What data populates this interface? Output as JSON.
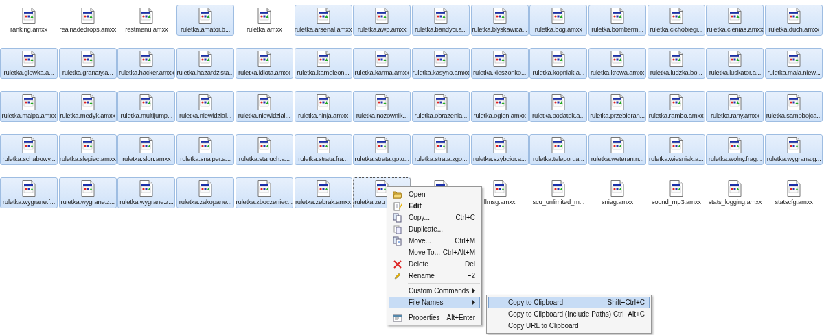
{
  "files": [
    {
      "label": "ranking.amxx",
      "selected": false,
      "focused": false
    },
    {
      "label": "realnadedrops.amxx",
      "selected": false,
      "focused": false
    },
    {
      "label": "restmenu.amxx",
      "selected": false,
      "focused": false
    },
    {
      "label": "ruletka.amator.b...",
      "selected": true,
      "focused": false
    },
    {
      "label": "ruletka.amxx",
      "selected": false,
      "focused": false
    },
    {
      "label": "ruletka.arsenal.amxx",
      "selected": true,
      "focused": false
    },
    {
      "label": "ruletka.awp.amxx",
      "selected": true,
      "focused": false
    },
    {
      "label": "ruletka.bandyci.a...",
      "selected": true,
      "focused": false
    },
    {
      "label": "ruletka.blyskawica...",
      "selected": true,
      "focused": false
    },
    {
      "label": "ruletka.bog.amxx",
      "selected": true,
      "focused": false
    },
    {
      "label": "ruletka.bomberm...",
      "selected": true,
      "focused": false
    },
    {
      "label": "ruletka.cichobiegi...",
      "selected": true,
      "focused": false
    },
    {
      "label": "ruletka.cienias.amxx",
      "selected": true,
      "focused": false
    },
    {
      "label": "ruletka.duch.amxx",
      "selected": true,
      "focused": false
    },
    {
      "label": "ruletka.glowka.a...",
      "selected": true,
      "focused": false
    },
    {
      "label": "ruletka.granaty.a...",
      "selected": true,
      "focused": false
    },
    {
      "label": "ruletka.hacker.amxx",
      "selected": true,
      "focused": false
    },
    {
      "label": "ruletka.hazardzista...",
      "selected": true,
      "focused": false
    },
    {
      "label": "ruletka.idiota.amxx",
      "selected": true,
      "focused": false
    },
    {
      "label": "ruletka.kameleon...",
      "selected": true,
      "focused": false
    },
    {
      "label": "ruletka.karma.amxx",
      "selected": true,
      "focused": false
    },
    {
      "label": "ruletka.kasyno.amxx",
      "selected": true,
      "focused": false
    },
    {
      "label": "ruletka.kieszonko...",
      "selected": true,
      "focused": false
    },
    {
      "label": "ruletka.kopniak.a...",
      "selected": true,
      "focused": false
    },
    {
      "label": "ruletka.krowa.amxx",
      "selected": true,
      "focused": false
    },
    {
      "label": "ruletka.ludzka.bo...",
      "selected": true,
      "focused": false
    },
    {
      "label": "ruletka.luskator.a...",
      "selected": true,
      "focused": false
    },
    {
      "label": "ruletka.mala.niew...",
      "selected": true,
      "focused": false
    },
    {
      "label": "ruletka.malpa.amxx",
      "selected": true,
      "focused": false
    },
    {
      "label": "ruletka.medyk.amxx",
      "selected": true,
      "focused": false
    },
    {
      "label": "ruletka.multijump...",
      "selected": true,
      "focused": false
    },
    {
      "label": "ruletka.niewidzial...",
      "selected": true,
      "focused": false
    },
    {
      "label": "ruletka.niewidzial...",
      "selected": true,
      "focused": false
    },
    {
      "label": "ruletka.ninja.amxx",
      "selected": true,
      "focused": false
    },
    {
      "label": "ruletka.nozownik...",
      "selected": true,
      "focused": false
    },
    {
      "label": "ruletka.obrazenia...",
      "selected": true,
      "focused": false
    },
    {
      "label": "ruletka.ogien.amxx",
      "selected": true,
      "focused": false
    },
    {
      "label": "ruletka.podatek.a...",
      "selected": true,
      "focused": false
    },
    {
      "label": "ruletka.przebieran...",
      "selected": true,
      "focused": false
    },
    {
      "label": "ruletka.rambo.amxx",
      "selected": true,
      "focused": false
    },
    {
      "label": "ruletka.rany.amxx",
      "selected": true,
      "focused": false
    },
    {
      "label": "ruletka.samobojca...",
      "selected": true,
      "focused": false
    },
    {
      "label": "ruletka.schabowy...",
      "selected": true,
      "focused": false
    },
    {
      "label": "ruletka.slepiec.amxx",
      "selected": true,
      "focused": false
    },
    {
      "label": "ruletka.slon.amxx",
      "selected": true,
      "focused": false
    },
    {
      "label": "ruletka.snajper.a...",
      "selected": true,
      "focused": false
    },
    {
      "label": "ruletka.staruch.a...",
      "selected": true,
      "focused": false
    },
    {
      "label": "ruletka.strata.fra...",
      "selected": true,
      "focused": false
    },
    {
      "label": "ruletka.strata.goto...",
      "selected": true,
      "focused": false
    },
    {
      "label": "ruletka.strata.zgo...",
      "selected": true,
      "focused": false
    },
    {
      "label": "ruletka.szybcior.a...",
      "selected": true,
      "focused": false
    },
    {
      "label": "ruletka.teleport.a...",
      "selected": true,
      "focused": false
    },
    {
      "label": "ruletka.weteran.n...",
      "selected": true,
      "focused": false
    },
    {
      "label": "ruletka.wiesniak.a...",
      "selected": true,
      "focused": false
    },
    {
      "label": "ruletka.wolny.frag...",
      "selected": true,
      "focused": false
    },
    {
      "label": "ruletka.wygrana.g...",
      "selected": true,
      "focused": false
    },
    {
      "label": "ruletka.wygrane.f...",
      "selected": true,
      "focused": false
    },
    {
      "label": "ruletka.wygrane.z...",
      "selected": true,
      "focused": false
    },
    {
      "label": "ruletka.wygrane.z...",
      "selected": true,
      "focused": false
    },
    {
      "label": "ruletka.zakopane...",
      "selected": true,
      "focused": false
    },
    {
      "label": "ruletka.zboczeniec...",
      "selected": true,
      "focused": false
    },
    {
      "label": "ruletka.zebrak.amxx",
      "selected": true,
      "focused": false
    },
    {
      "label": "ruletka.zeu",
      "selected": true,
      "focused": true
    },
    {
      "selected": false,
      "focused": false
    },
    {
      "label": "llmsg.amxx",
      "selected": false,
      "focused": false
    },
    {
      "label": "scu_unlimited_m...",
      "selected": false,
      "focused": false
    },
    {
      "label": "snieg.amxx",
      "selected": false,
      "focused": false
    },
    {
      "label": "sound_mp3.amxx",
      "selected": false,
      "focused": false
    },
    {
      "label": "stats_logging.amxx",
      "selected": false,
      "focused": false
    },
    {
      "label": "statscfg.amxx",
      "selected": false,
      "focused": false
    }
  ],
  "context_menu": {
    "sections": [
      [
        {
          "label": "Open",
          "bold": false,
          "submenu": false,
          "selected": false
        },
        {
          "label": "Edit",
          "bold": true,
          "submenu": false,
          "selected": false
        },
        {
          "label": "Copy...",
          "shortcut": "Ctrl+C",
          "bold": false,
          "submenu": false,
          "selected": false
        },
        {
          "label": "Duplicate...",
          "bold": false,
          "submenu": false,
          "selected": false
        },
        {
          "label": "Move...",
          "shortcut": "Ctrl+M",
          "bold": false,
          "submenu": false,
          "selected": false
        },
        {
          "label": "Move To...",
          "shortcut": "Ctrl+Alt+M",
          "bold": false,
          "submenu": false,
          "selected": false
        },
        {
          "label": "Delete",
          "shortcut": "Del",
          "bold": false,
          "submenu": false,
          "selected": false
        },
        {
          "label": "Rename",
          "shortcut": "F2",
          "bold": false,
          "submenu": false,
          "selected": false
        }
      ],
      [
        {
          "label": "Custom Commands",
          "bold": false,
          "submenu": true,
          "selected": false
        },
        {
          "label": "File Names",
          "bold": false,
          "submenu": true,
          "selected": true
        }
      ],
      [
        {
          "label": "Properties",
          "shortcut": "Alt+Enter",
          "bold": false,
          "submenu": false,
          "selected": false
        }
      ]
    ]
  },
  "submenu": {
    "items": [
      {
        "label": "Copy to Clipboard",
        "shortcut": "Shift+Ctrl+C",
        "selected": true
      },
      {
        "label": "Copy to Clipboard (Include Paths)",
        "shortcut": "Ctrl+Alt+C",
        "selected": false
      },
      {
        "label": "Copy URL to Clipboard",
        "selected": false
      }
    ]
  }
}
